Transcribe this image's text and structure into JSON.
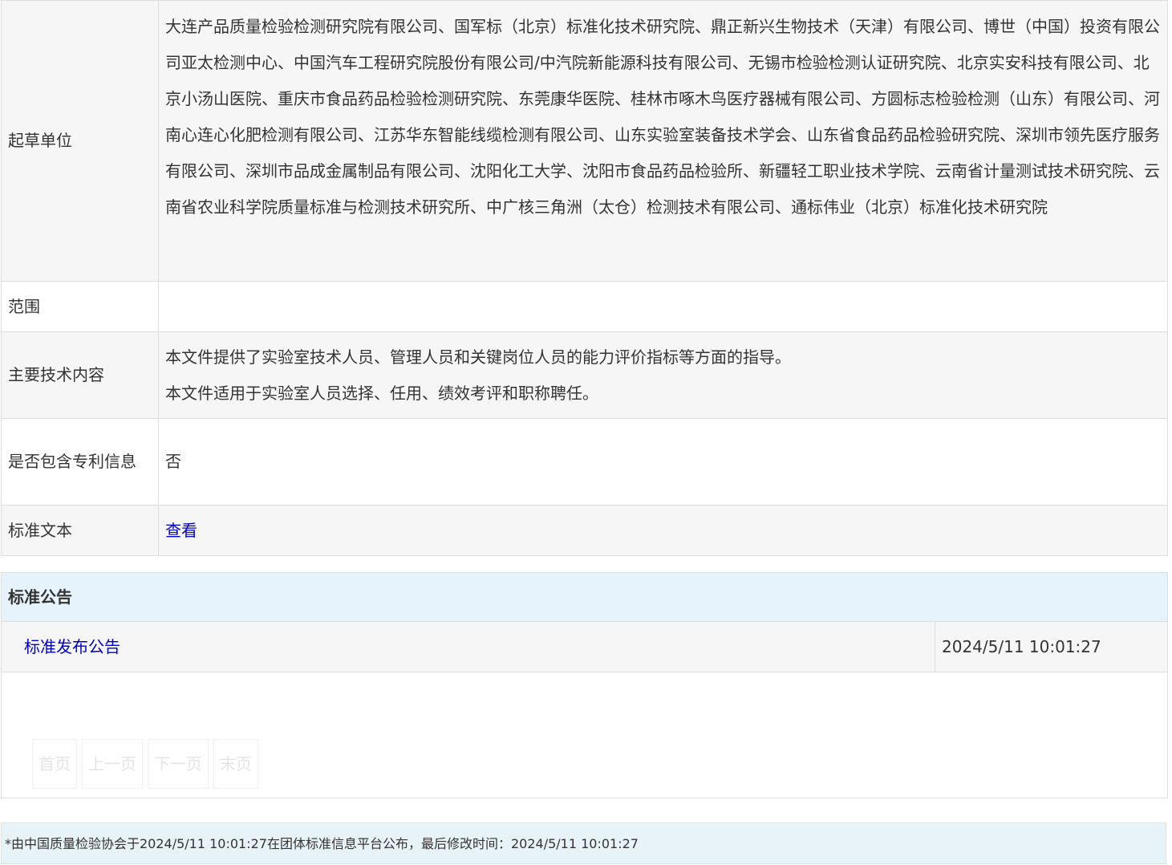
{
  "info_table": {
    "drafters": {
      "label": "起草单位",
      "value": "大连产品质量检验检测研究院有限公司、国军标（北京）标准化技术研究院、鼎正新兴生物技术（天津）有限公司、博世（中国）投资有限公司亚太检测中心、中国汽车工程研究院股份有限公司/中汽院新能源科技有限公司、无锡市检验检测认证研究院、北京实安科技有限公司、北京小汤山医院、重庆市食品药品检验检测研究院、东莞康华医院、桂林市啄木鸟医疗器械有限公司、方圆标志检验检测（山东）有限公司、河南心连心化肥检测有限公司、江苏华东智能线缆检测有限公司、山东实验室装备技术学会、山东省食品药品检验研究院、深圳市领先医疗服务有限公司、深圳市品成金属制品有限公司、沈阳化工大学、沈阳市食品药品检验所、新疆轻工职业技术学院、云南省计量测试技术研究院、云南省农业科学院质量标准与检测技术研究所、中广核三角洲（太仓）检测技术有限公司、通标伟业（北京）标准化技术研究院"
    },
    "scope": {
      "label": "范围",
      "value": ""
    },
    "tech_content": {
      "label": "主要技术内容",
      "line1": "本文件提供了实验室技术人员、管理人员和关键岗位人员的能力评价指标等方面的指导。",
      "line2": "本文件适用于实验室人员选择、任用、绩效考评和职称聘任。"
    },
    "patent": {
      "label": "是否包含专利信息",
      "value": "否"
    },
    "standard_text": {
      "label": "标准文本",
      "link": "查看"
    }
  },
  "notices": {
    "header": "标准公告",
    "items": [
      {
        "title": "标准发布公告",
        "date": "2024/5/11 10:01:27"
      }
    ],
    "pager": {
      "first": "首页",
      "prev": "上一页",
      "next": "下一页",
      "last": "末页"
    }
  },
  "footer": {
    "note": "*由中国质量检验协会于2024/5/11 10:01:27在团体标准信息平台公布，最后修改时间：2024/5/11 10:01:27"
  }
}
